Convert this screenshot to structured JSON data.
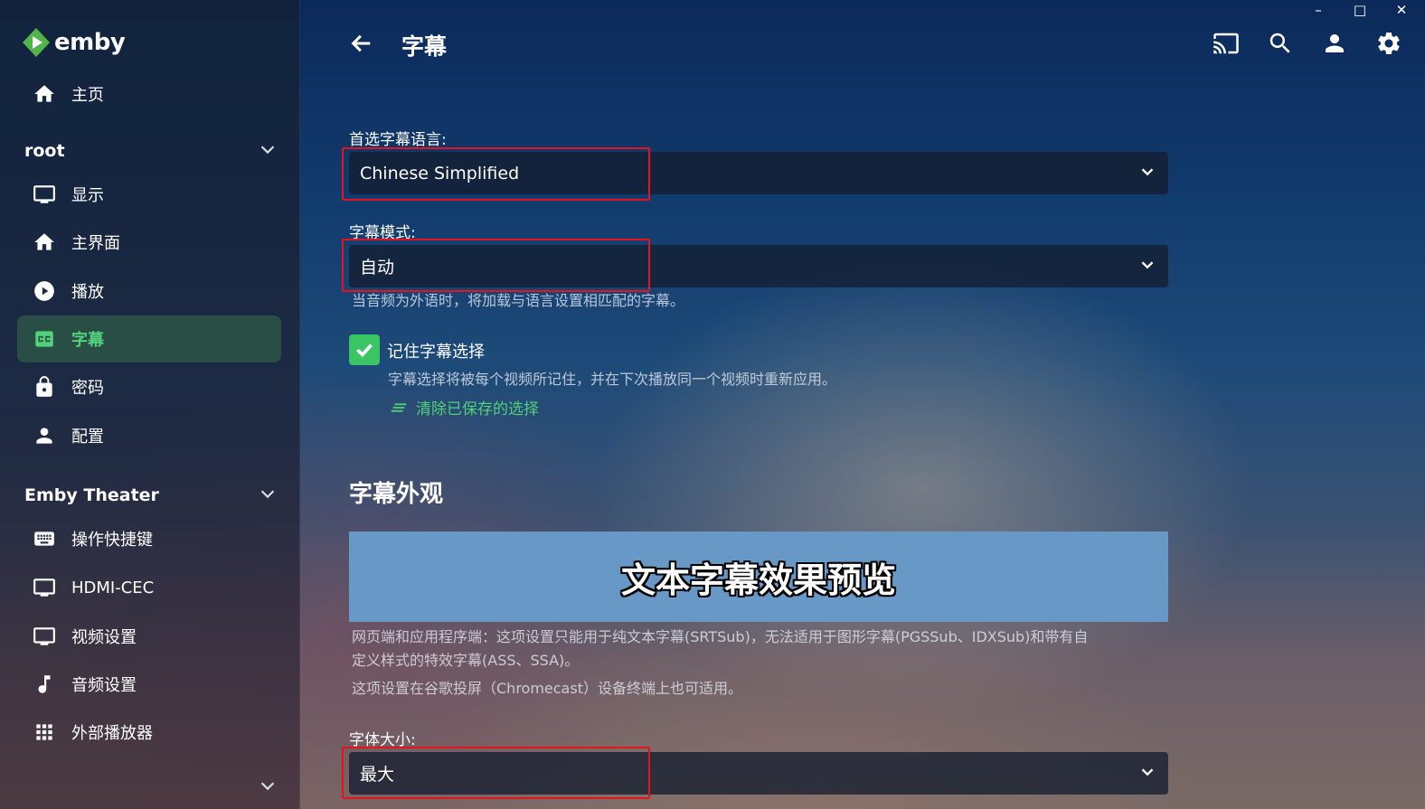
{
  "app": {
    "logo_text": "emby"
  },
  "window": {
    "minimize": "–",
    "maximize": "□",
    "close": "✕"
  },
  "header": {
    "title": "字幕"
  },
  "sidebar": {
    "home": "主页",
    "section_user": "root",
    "user_items": [
      {
        "label": "显示",
        "icon": "monitor-icon"
      },
      {
        "label": "主界面",
        "icon": "home-icon"
      },
      {
        "label": "播放",
        "icon": "play-icon"
      },
      {
        "label": "字幕",
        "icon": "cc-icon",
        "active": true
      },
      {
        "label": "密码",
        "icon": "lock-icon"
      },
      {
        "label": "配置",
        "icon": "person-icon"
      }
    ],
    "section_app": "Emby Theater",
    "app_items": [
      {
        "label": "操作快捷键",
        "icon": "keyboard-icon"
      },
      {
        "label": "HDMI-CEC",
        "icon": "monitor-icon"
      },
      {
        "label": "视频设置",
        "icon": "monitor-icon"
      },
      {
        "label": "音频设置",
        "icon": "music-note-icon"
      },
      {
        "label": "外部播放器",
        "icon": "grid-icon"
      }
    ]
  },
  "form": {
    "language_label": "首选字幕语言:",
    "language_value": "Chinese Simplified",
    "mode_label": "字幕模式:",
    "mode_value": "自动",
    "mode_help": "当音频为外语时，将加载与语言设置相匹配的字幕。",
    "remember_label": "记住字幕选择",
    "remember_checked": true,
    "remember_help": "字幕选择将被每个视频所记住，并在下次播放同一个视频时重新应用。",
    "clear_link": "清除已保存的选择",
    "appearance_heading": "字幕外观",
    "preview_text": "文本字幕效果预览",
    "preview_bg": "#6898c6",
    "appearance_help_1": "网页端和应用程序端：这项设置只能用于纯文本字幕(SRTSub)，无法适用于图形字幕(PGSSub、IDXSub)和带有自",
    "appearance_help_2": "定义样式的特效字幕(ASS、SSA)。",
    "appearance_help_3": "这项设置在谷歌投屏（Chromecast）设备终端上也可适用。",
    "font_size_label": "字体大小:",
    "font_size_value": "最大"
  },
  "colors": {
    "accent": "#52d07a",
    "highlight_box": "#e3141c"
  }
}
